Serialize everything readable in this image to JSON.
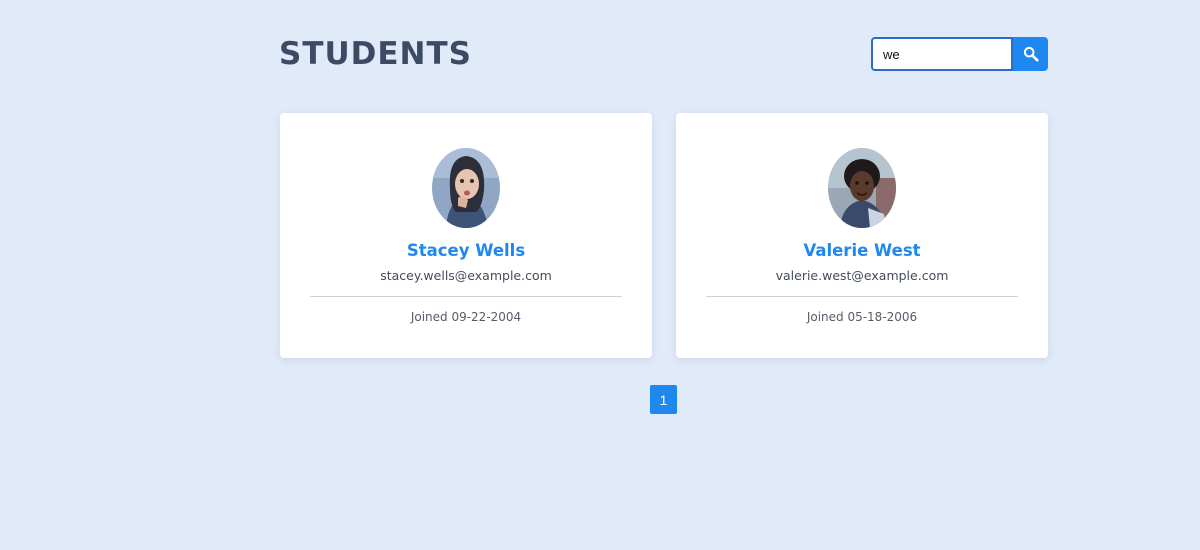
{
  "header": {
    "title": "STUDENTS"
  },
  "search": {
    "value": "we",
    "icon": "search-icon"
  },
  "students": [
    {
      "name": "Stacey Wells",
      "email": "stacey.wells@example.com",
      "joined": "Joined 09-22-2004"
    },
    {
      "name": "Valerie West",
      "email": "valerie.west@example.com",
      "joined": "Joined 05-18-2006"
    }
  ],
  "pagination": {
    "current": "1"
  },
  "colors": {
    "background": "#e1eaf8",
    "accent": "#1e88f0",
    "title": "#3c4a64"
  }
}
